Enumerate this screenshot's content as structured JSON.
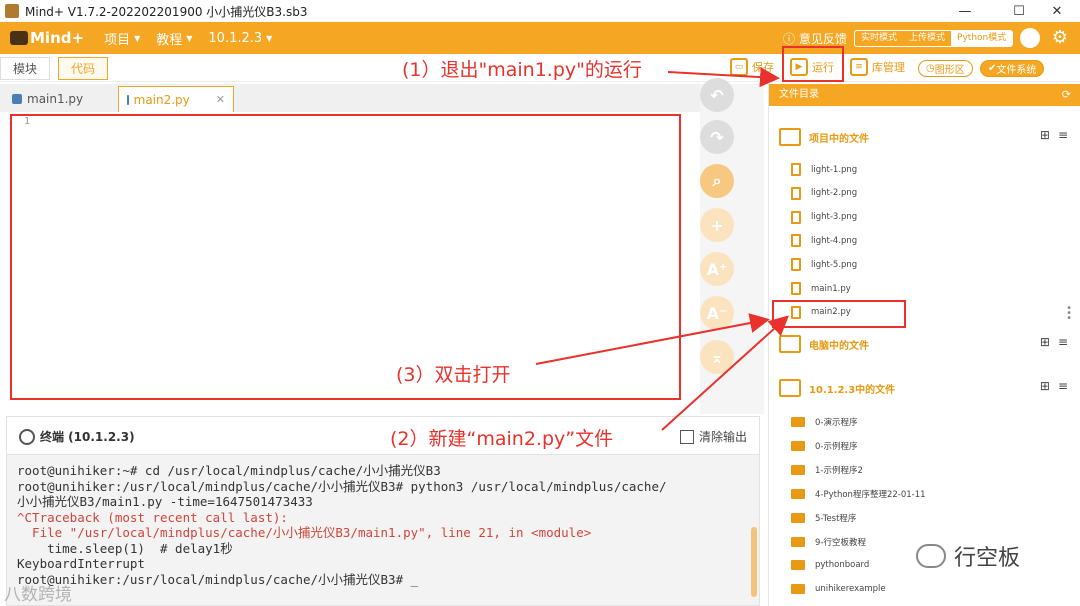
{
  "window": {
    "title": "Mind+ V1.7.2-202202201900   小小捕光仪B3.sb3",
    "min": "—",
    "max": "☐",
    "close": "✕"
  },
  "menubar": {
    "logo": "Mind+",
    "menus": [
      "项目",
      "教程",
      "10.1.2.3"
    ],
    "feedback": "意见反馈",
    "modes": [
      "实时模式",
      "上传模式",
      "Python模式"
    ]
  },
  "toolbar": {
    "view_tabs": [
      "模块",
      "代码"
    ],
    "save": "保存",
    "run": "运行",
    "libs": "库管理",
    "graphic": "图形区",
    "filesystem": "文件系统"
  },
  "editor": {
    "tabs": [
      {
        "label": "main1.py"
      },
      {
        "label": "main2.py",
        "close": "✕"
      }
    ],
    "line_numbers": [
      "1"
    ]
  },
  "side_tools": [
    "undo-icon",
    "redo-icon",
    "search-icon",
    "add-icon",
    "font-increase-icon",
    "font-decrease-icon",
    "collapse-icon"
  ],
  "terminal": {
    "title": "终端 (10.1.2.3)",
    "clear": "清除输出",
    "lines": [
      {
        "text": "root@unihiker:~# cd /usr/local/mindplus/cache/小小捕光仪B3",
        "err": false
      },
      {
        "text": "root@unihiker:/usr/local/mindplus/cache/小小捕光仪B3# python3 /usr/local/mindplus/cache/",
        "err": false
      },
      {
        "text": "小小捕光仪B3/main1.py -time=1647501473433",
        "err": false
      },
      {
        "text": "^CTraceback (most recent call last):",
        "err": true
      },
      {
        "text": "  File \"/usr/local/mindplus/cache/小小捕光仪B3/main1.py\", line 21, in <module>",
        "err": true
      },
      {
        "text": "    time.sleep(1)  # delay1秒",
        "err": false
      },
      {
        "text": "KeyboardInterrupt",
        "err": false
      },
      {
        "text": "root@unihiker:/usr/local/mindplus/cache/小小捕光仪B3# _",
        "err": false
      }
    ]
  },
  "files": {
    "header": "文件目录",
    "project_section": "项目中的文件",
    "project_files": [
      "light-1.png",
      "light-2.png",
      "light-3.png",
      "light-4.png",
      "light-5.png",
      "main1.py",
      "main2.py"
    ],
    "pc_section": "电脑中的文件",
    "device_section": "10.1.2.3中的文件",
    "device_folders": [
      "0-演示程序",
      "0-示例程序",
      "1-示例程序2",
      "4-Python程序整理22-01-11",
      "5-Test程序",
      "9-行空板教程",
      "pythonboard",
      "unihikerexample"
    ]
  },
  "annotations": {
    "step1": "(1）退出\"main1.py\"的运行",
    "step2": "(2）新建“main2.py”文件",
    "step3": "(3）双击打开"
  },
  "watermark": {
    "brand": "行空板",
    "corner": "八数跨境"
  },
  "colors": {
    "accent": "#f5a623",
    "annotation": "#e8322b"
  }
}
